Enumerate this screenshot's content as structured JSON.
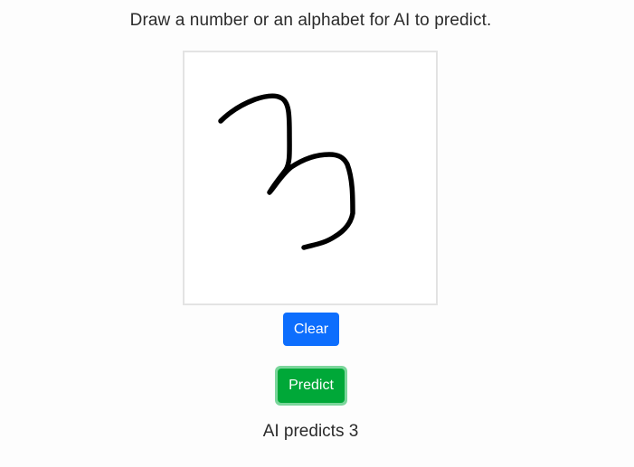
{
  "instruction": "Draw a number or an alphabet for AI to predict.",
  "buttons": {
    "clear_label": "Clear",
    "predict_label": "Predict"
  },
  "result_text": "AI predicts 3",
  "colors": {
    "clear_button": "#0d6efd",
    "predict_button": "#00a838",
    "predict_focus_ring": "#7bd69b",
    "stroke": "#000000"
  }
}
